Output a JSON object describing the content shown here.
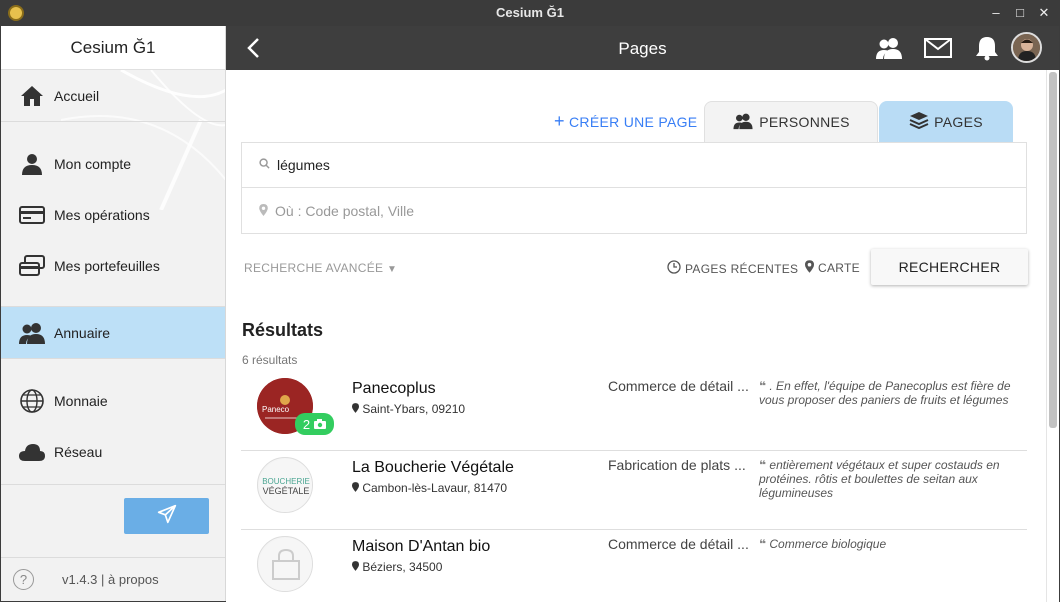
{
  "window": {
    "title": "Cesium Ğ1"
  },
  "sidebar": {
    "title": "Cesium Ğ1",
    "items": [
      {
        "label": "Accueil",
        "icon": "home-icon"
      },
      {
        "label": "Mon compte",
        "icon": "person-icon"
      },
      {
        "label": "Mes opérations",
        "icon": "card-icon"
      },
      {
        "label": "Mes portefeuilles",
        "icon": "cards-icon"
      },
      {
        "label": "Annuaire",
        "icon": "people-icon"
      },
      {
        "label": "Monnaie",
        "icon": "globe-icon"
      },
      {
        "label": "Réseau",
        "icon": "cloud-icon"
      }
    ],
    "footer": {
      "help": "?",
      "version": "v1.4.3 | à propos"
    }
  },
  "header": {
    "title": "Pages"
  },
  "content": {
    "create_label": "CRÉER UNE PAGE",
    "tabs": {
      "persons": "PERSONNES",
      "pages": "PAGES"
    },
    "search_value": "légumes",
    "location_placeholder": "Où : Code postal, Ville",
    "advanced_label": "RECHERCHE AVANCÉE",
    "recent_label": "PAGES RÉCENTES",
    "map_label": "CARTE",
    "search_button": "RECHERCHER",
    "results_title": "Résultats",
    "results_count": "6 résultats",
    "results": [
      {
        "name": "Panecoplus",
        "location": "Saint-Ybars, 09210",
        "category": "Commerce de détail ...",
        "description": ". En effet, l'équipe de Panecoplus est fière de vous proposer des paniers de fruits et légumes",
        "badge": "2"
      },
      {
        "name": "La Boucherie Végétale",
        "location": "Cambon-lès-Lavaur, 81470",
        "category": "Fabrication de plats ...",
        "description": "entièrement végétaux et super costauds en protéines. rôtis et boulettes de seitan aux légumineuses"
      },
      {
        "name": "Maison D'Antan bio",
        "location": "Béziers, 34500",
        "category": "Commerce de détail ...",
        "description": "Commerce biologique"
      }
    ],
    "logo_texts": {
      "panecoplus": "Paneco",
      "boucherie_top": "BOUCHERIE",
      "boucherie_bottom": "VÉGÉTALE"
    }
  }
}
